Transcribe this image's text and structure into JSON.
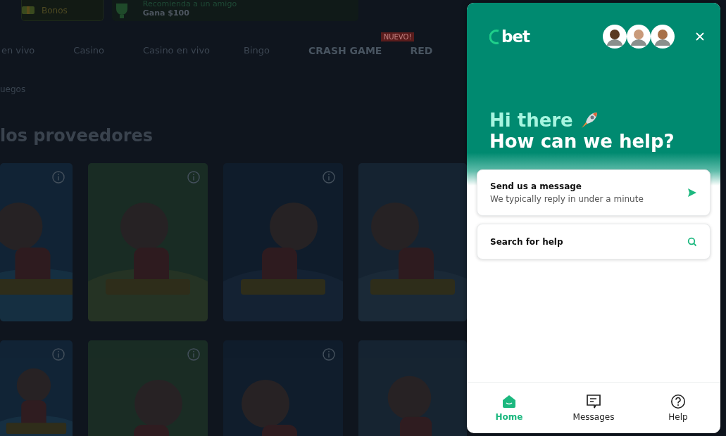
{
  "promo_bar": {
    "bonus_label": "Bonos",
    "referral_title": "Recomienda a un amigo",
    "referral_subtitle": "Gana $100"
  },
  "nav": [
    {
      "kind": "text",
      "label": "en vivo"
    },
    {
      "kind": "text",
      "label": "Casino"
    },
    {
      "kind": "text",
      "label": "Casino en vivo"
    },
    {
      "kind": "text",
      "label": "Bingo"
    },
    {
      "kind": "logo",
      "label": "CRASH GAME",
      "badge": "NUEVO!"
    },
    {
      "kind": "logo",
      "label": "RED"
    }
  ],
  "breadcrumb": "uegos",
  "heading": "los proveedores",
  "chat": {
    "brand": "bet",
    "greeting": "Hi there",
    "prompt": "How can we help?",
    "cards": [
      {
        "kind": "message",
        "title": "Send us a message",
        "subtitle": "We typically reply in under a minute"
      },
      {
        "kind": "search",
        "title": "Search for help"
      }
    ],
    "tabs": [
      {
        "kind": "home",
        "label": "Home",
        "selected": true
      },
      {
        "kind": "messages",
        "label": "Messages",
        "selected": false
      },
      {
        "kind": "help",
        "label": "Help",
        "selected": false
      }
    ]
  }
}
